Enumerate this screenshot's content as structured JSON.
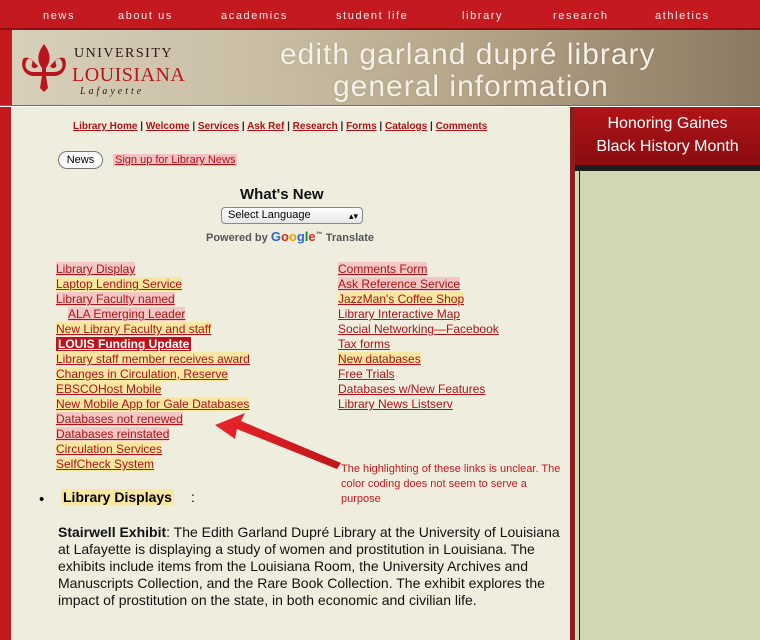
{
  "topnav": [
    "news",
    "about us",
    "academics",
    "student life",
    "library",
    "research",
    "athletics"
  ],
  "logo": {
    "line1": "UNIVERSITY",
    "line2": "LOUISIANA",
    "line3": "Lafayette"
  },
  "banner": {
    "title1": "edith garland dupré library",
    "title2": "general information"
  },
  "quicklinks": [
    "Library Home",
    "Welcome",
    "Services",
    "Ask Ref",
    "Research",
    "Forms",
    "Catalogs",
    "Comments"
  ],
  "news": {
    "button": "News",
    "signup": "Sign up for Library News"
  },
  "whats_new": {
    "title": "What's New",
    "select": "Select Language",
    "powered_by": "Powered by",
    "google": "Google",
    "translate": "Translate"
  },
  "left_links": [
    "Library Display",
    "Laptop Lending Service",
    "Library Faculty named",
    "ALA Emerging Leader",
    "New Library Faculty and staff",
    "LOUIS Funding Update",
    "Library staff member receives award",
    "Changes in Circulation, Reserve",
    "EBSCOHost Mobile",
    "New Mobile App for Gale Databases",
    "Databases not renewed",
    "Databases reinstated",
    "Circulation Services",
    "SelfCheck System"
  ],
  "right_links": [
    "Comments Form",
    "Ask Reference Service",
    "JazzMan's Coffee Shop",
    "Library Interactive Map",
    "Social Networking—Facebook",
    "Tax forms",
    "New databases",
    "Free Trials",
    "Databases w/New Features",
    "Library News Listserv"
  ],
  "annotation": "The highlighting of these links is unclear. The color coding does not seem to serve a purpose",
  "section": {
    "heading": "Library Displays",
    "colon": ":"
  },
  "exhibit": {
    "title": "Stairwell Exhibit",
    "text": ": The Edith Garland Dupré Library at the University of Louisiana at Lafayette is displaying a study of women and prostitution in Louisiana. The exhibits include items from the Louisiana Room, the University Archives and Manuscripts Collection, and the Rare Book Collection. The exhibit explores the impact of prostitution on the state, in both economic and civilian life."
  },
  "sidebar": {
    "line1": "Honoring Gaines",
    "line2": "Black History Month"
  },
  "colors": {
    "brand_red": "#c41a1f",
    "page_bg": "#efeede",
    "link_red": "#b01216",
    "highlight_pink": "#f2c7c4",
    "highlight_yellow": "#f7e7a0"
  }
}
